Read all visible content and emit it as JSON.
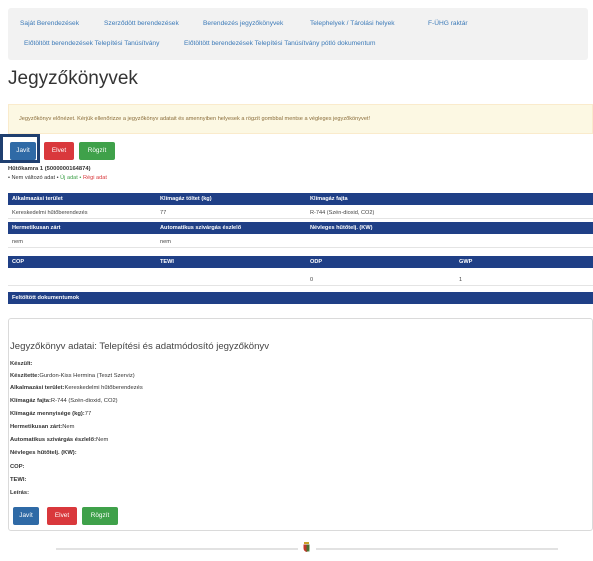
{
  "nav": {
    "items": [
      "Saját Berendezések",
      "Szerződött berendezések",
      "Berendezés jegyzőkönyvek",
      "Telephelyek / Tárolási helyek",
      "F-ÜHG raktár",
      "Előtöltött berendezések Telepítési Tanúsítvány",
      "Előtöltött berendezések Telepítési Tanúsítvány pótló dokumentum"
    ]
  },
  "page_title": "Jegyzőkönyvek",
  "alert": "Jegyzőkönyv előnézet. Kérjük ellenőrizze a jegyzőkönyv adatait és amennyiben helyesek a rögzít gombbal mentse a végleges jegyzőkönyvet!",
  "actions": {
    "edit": "Javít",
    "reject": "Elvet",
    "save": "Rögzít"
  },
  "device": {
    "name": "Hűtőkamra 1 (5000000164874)",
    "legend_unchanged": "• Nem változó adat •",
    "legend_new": "Új adat",
    "legend_sep": "•",
    "legend_old": "Régi adat"
  },
  "table": {
    "row1_headers": [
      "Alkalmazási terület",
      "Klímagáz töltet (kg)",
      "Klímagáz fajta"
    ],
    "row1_values": [
      "Kereskedelmi hűtőberendezés",
      "77",
      "R-744 (Szén-dioxid, CO2)"
    ],
    "row2_headers": [
      "Hermetikusan zárt",
      "Automatikus szivárgás észlelő",
      "Névleges hűtőtelj. (KW)"
    ],
    "row2_values": [
      "nem",
      "nem"
    ],
    "row3_headers": [
      "COP",
      "TEWI",
      "ODP",
      "GWP"
    ],
    "row3_values": [
      "0",
      "1"
    ],
    "docs_header": "Feltöltött dokumentumok"
  },
  "record": {
    "title": "Jegyzőkönyv adatai: Telepítési és adatmódosító jegyzőkönyv",
    "fields": [
      {
        "label": "Készült:",
        "value": ""
      },
      {
        "label": "Készítette:",
        "value": "Gurdon-Kiss Hermina (Teszt Szerviz)"
      },
      {
        "label": "Alkalmazási terület:",
        "value": "Kereskedelmi hűtőberendezés"
      },
      {
        "label": "Klímagáz fajta:",
        "value": "R-744 (Szén-dioxid, CO2)"
      },
      {
        "label": "Klímagáz mennyisége (kg):",
        "value": "77"
      },
      {
        "label": "Hermetikusan zárt:",
        "value": "Nem"
      },
      {
        "label": "Automatikus szivárgás észlelő:",
        "value": "Nem"
      },
      {
        "label": "Névleges hűtőtelj. (KW):",
        "value": ""
      },
      {
        "label": "COP:",
        "value": ""
      },
      {
        "label": "TEWI:",
        "value": ""
      },
      {
        "label": "Leírás:",
        "value": ""
      }
    ]
  },
  "colors": {
    "table_header": "#1f3f86",
    "button_blue": "#2f6aa6",
    "button_red": "#d9383c",
    "button_green": "#3fa14a",
    "alert_bg": "#fcf8e3"
  },
  "icons": {
    "footer": "coat-of-arms-icon"
  }
}
